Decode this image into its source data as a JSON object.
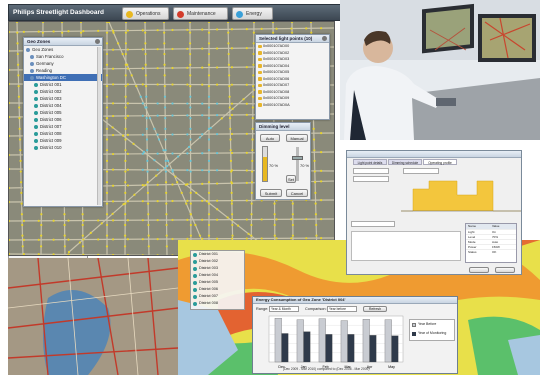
{
  "header": {
    "title": "Philips Streetlight Dashboard",
    "tabs": [
      {
        "label": "Operations",
        "color": "#e8b820"
      },
      {
        "label": "Maintenance",
        "color": "#d33c2b"
      },
      {
        "label": "Energy",
        "color": "#3aa0d8"
      }
    ]
  },
  "tree_panel": {
    "title": "Geo Zones",
    "items": [
      "Geo Zones",
      "San Francisco",
      "Germany",
      "Reading",
      "Washington DC",
      "District 001",
      "District 002",
      "District 003",
      "District 004",
      "District 005",
      "District 006",
      "District 007",
      "District 008",
      "District 009",
      "District 010"
    ],
    "selected_index": 4
  },
  "lightpoints_panel": {
    "title": "Selected light points (10)",
    "items": [
      "0x000107AD00",
      "0x000107AD02",
      "0x000107AD03",
      "0x000107AD04",
      "0x000107AD05",
      "0x000107AD06",
      "0x000107AD07",
      "0x000107AD08",
      "0x000107AD09",
      "0x000107AD0A"
    ]
  },
  "dimming_panel": {
    "title": "Dimming level",
    "mode_auto": "Auto",
    "mode_manual": "Manual",
    "left_level": "70 %",
    "right_level": "70 %",
    "set_label": "Set",
    "submit_label": "Submit",
    "cancel_label": "Cancel"
  },
  "left_window": {
    "search_placeholder": "Enter a geozone name",
    "items": [
      "District 027",
      "District 028",
      "District 029",
      "District 030",
      "District 031",
      "District 032",
      "District 033",
      "District 034",
      "District 035",
      "District 036"
    ]
  },
  "analytics_window": {
    "tabs": [
      "Light point details",
      "Dimming schedule",
      "Operating profile"
    ],
    "table_headers": [
      "Name",
      "Value"
    ],
    "table_rows": [
      [
        "Light",
        "On"
      ],
      [
        "Level",
        "70%"
      ],
      [
        "Mode",
        "Auto"
      ],
      [
        "Power",
        "150W"
      ],
      [
        "Status",
        "OK"
      ]
    ]
  },
  "energy_chart": {
    "title": "Energy Consumption of Geo Zone 'District 004'",
    "range_label": "Range:",
    "range_value": "Year & Month",
    "comparison_label": "Comparison:",
    "comparison_value": "Year before",
    "refresh_label": "Refresh",
    "legend": [
      "Year Before",
      "Year of Monitoring"
    ],
    "footer": "(Dec 2009 - Mar 2010) compared to (Dec 2008 - Mar 2009)"
  },
  "chart_data": {
    "type": "bar",
    "categories": [
      "Dec",
      "Jan",
      "Feb",
      "Mar",
      "Apr",
      "May"
    ],
    "series": [
      {
        "name": "Year Before",
        "values": [
          95,
          92,
          94,
          90,
          93,
          92
        ]
      },
      {
        "name": "Year of Monitoring",
        "values": [
          62,
          66,
          60,
          60,
          58,
          57
        ]
      }
    ],
    "ylim": [
      0,
      100
    ],
    "colors": [
      "#c9ccd2",
      "#2f3a4a"
    ]
  },
  "colors": {
    "header_bg": "#4b5663",
    "map_bg": "#8a8a7a",
    "selected_row": "#3f6fb5",
    "lightpoint": "#e7d430",
    "selected_lightpoint": "#69c6d8"
  }
}
